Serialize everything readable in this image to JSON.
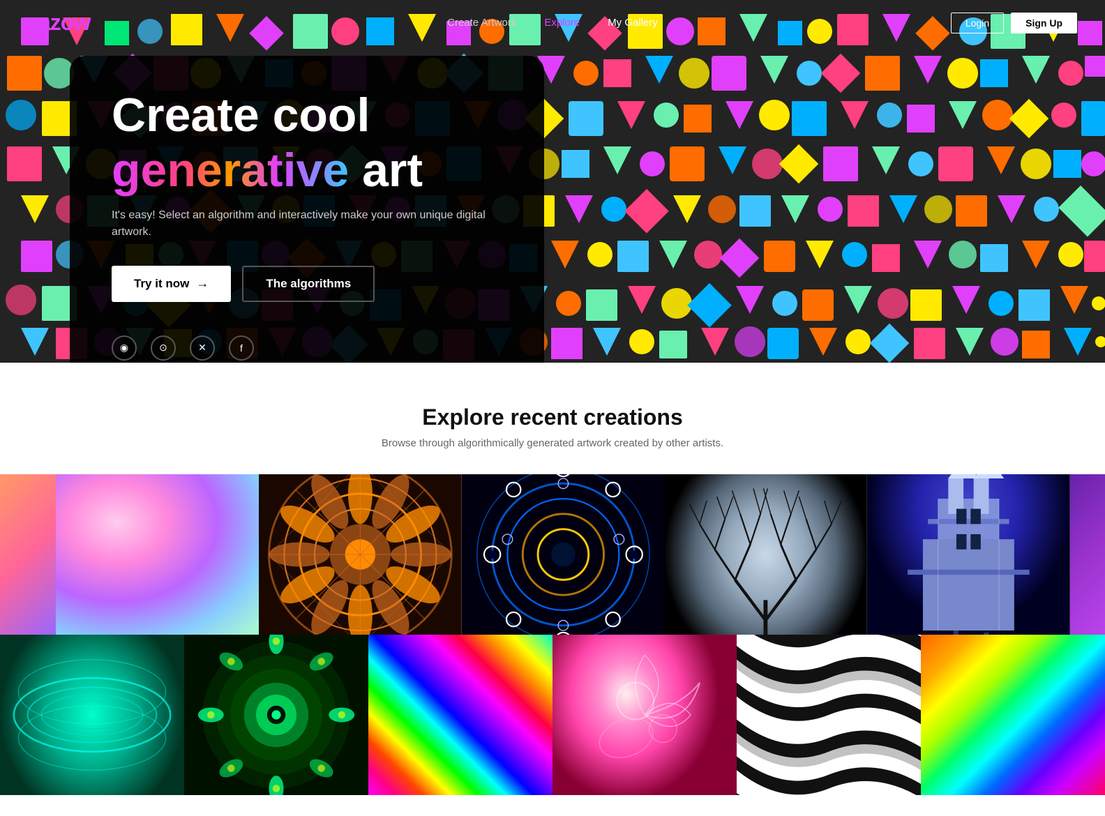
{
  "brand": {
    "name_start": "zazo",
    "name_end": "w"
  },
  "nav": {
    "links": [
      {
        "label": "Create Artwork",
        "active": false
      },
      {
        "label": "Explore",
        "active": true
      },
      {
        "label": "My Gallery",
        "active": false
      }
    ],
    "login_label": "Login",
    "signup_label": "Sign Up"
  },
  "hero": {
    "title_line1": "Create cool",
    "title_line2_gen": "generative",
    "title_line2_art": " art",
    "subtitle": "It's easy! Select an algorithm and interactively make your own unique digital artwork.",
    "btn_try": "Try it now",
    "btn_algorithms": "The algorithms",
    "arrow": "→"
  },
  "social": {
    "icons": [
      {
        "name": "instagram-icon",
        "symbol": "◉"
      },
      {
        "name": "reddit-icon",
        "symbol": "⊙"
      },
      {
        "name": "twitter-icon",
        "symbol": "𝕏"
      },
      {
        "name": "facebook-icon",
        "symbol": "f"
      }
    ]
  },
  "explore": {
    "title": "Explore recent creations",
    "subtitle": "Browse through algorithmically generated artwork created by other artists."
  },
  "gallery_row1": [
    {
      "id": "art-partial-left",
      "class": "art-partial-left"
    },
    {
      "id": "art-2",
      "class": "art-2"
    },
    {
      "id": "art-fractal-orange",
      "class": "art-fractal-orange"
    },
    {
      "id": "art-dark-mandala",
      "class": "art-dark-mandala"
    },
    {
      "id": "art-fractal-tree",
      "class": "art-5"
    },
    {
      "id": "art-castle-blue",
      "class": "art-castle-blue"
    },
    {
      "id": "art-partial-right",
      "class": "art-6"
    }
  ],
  "gallery_row2": [
    {
      "id": "art-wavy-green",
      "class": "art-wavy-green"
    },
    {
      "id": "art-peacock",
      "class": "art-peacock"
    },
    {
      "id": "art-psychedelic",
      "class": "art-psychedelic"
    },
    {
      "id": "art-pink-swirl",
      "class": "art-pink-swirl"
    },
    {
      "id": "art-zebra",
      "class": "art-zebra"
    },
    {
      "id": "art-colorful-right",
      "class": "art-colorful-right"
    }
  ]
}
